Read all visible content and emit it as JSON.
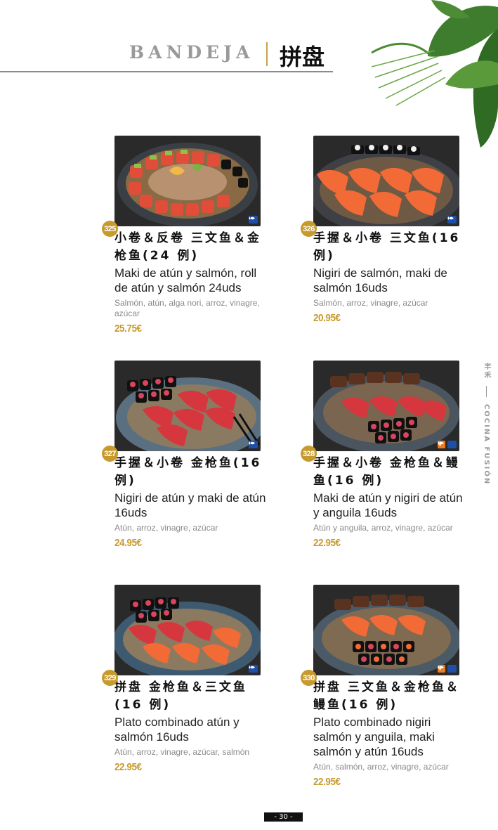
{
  "header": {
    "title_latin": "BANDEJA",
    "title_cn": "拼盘"
  },
  "side": {
    "brand_cn": "丰禾",
    "tagline": "COCINA FUSIÓN"
  },
  "colors": {
    "accent_gold": "#c89a2e",
    "gray": "#9a9a9a",
    "fish_badge": "#1f4fa8",
    "spicy_badge": "#f07a1a"
  },
  "items": [
    {
      "number": "325",
      "name_cn": "小卷＆反卷 三文鱼＆金枪鱼(24 例)",
      "name_es": "Maki de atún y salmón, roll de atún y salmón 24uds",
      "ingredients": "Salmón, atún, alga nori, arroz, vinagre, azúcar",
      "price": "25.75€",
      "icons": [
        "fish-icon"
      ]
    },
    {
      "number": "326",
      "name_cn": "手握＆小卷 三文鱼(16 例)",
      "name_es": "Nigiri de salmón, maki de salmón 16uds",
      "ingredients": "Salmón, arroz, vinagre, azúcar",
      "price": "20.95€",
      "icons": [
        "fish-icon"
      ]
    },
    {
      "number": "327",
      "name_cn": "手握＆小卷 金枪鱼(16 例)",
      "name_es": "Nigiri de atún y maki de atún 16uds",
      "ingredients": "Atún, arroz, vinagre, azúcar",
      "price": "24.95€",
      "icons": [
        "fish-icon"
      ]
    },
    {
      "number": "328",
      "name_cn": "手握＆小卷 金枪鱼＆鳗鱼(16 例)",
      "name_es": "Maki de atún y nigiri de atún y anguila 16uds",
      "ingredients": "Atún y anguila, arroz, vinagre, azúcar",
      "price": "22.95€",
      "icons": [
        "spicy-icon",
        "fish-icon"
      ]
    },
    {
      "number": "329",
      "name_cn": "拼盘 金枪鱼＆三文鱼(16 例)",
      "name_es": "Plato combinado atún y salmón 16uds",
      "ingredients": "Atún, arroz, vinagre, azúcar, salmón",
      "price": "22.95€",
      "icons": [
        "fish-icon"
      ]
    },
    {
      "number": "330",
      "name_cn": "拼盘 三文鱼＆金枪鱼＆鳗鱼(16 例)",
      "name_es": "Plato combinado nigiri salmón y anguila, maki salmón y atún 16uds",
      "ingredients": "Atún, salmón, arroz, vinagre, azúcar",
      "price": "22.95€",
      "icons": [
        "spicy-icon",
        "fish-icon"
      ]
    }
  ],
  "footer": {
    "page": "- 30 -"
  }
}
